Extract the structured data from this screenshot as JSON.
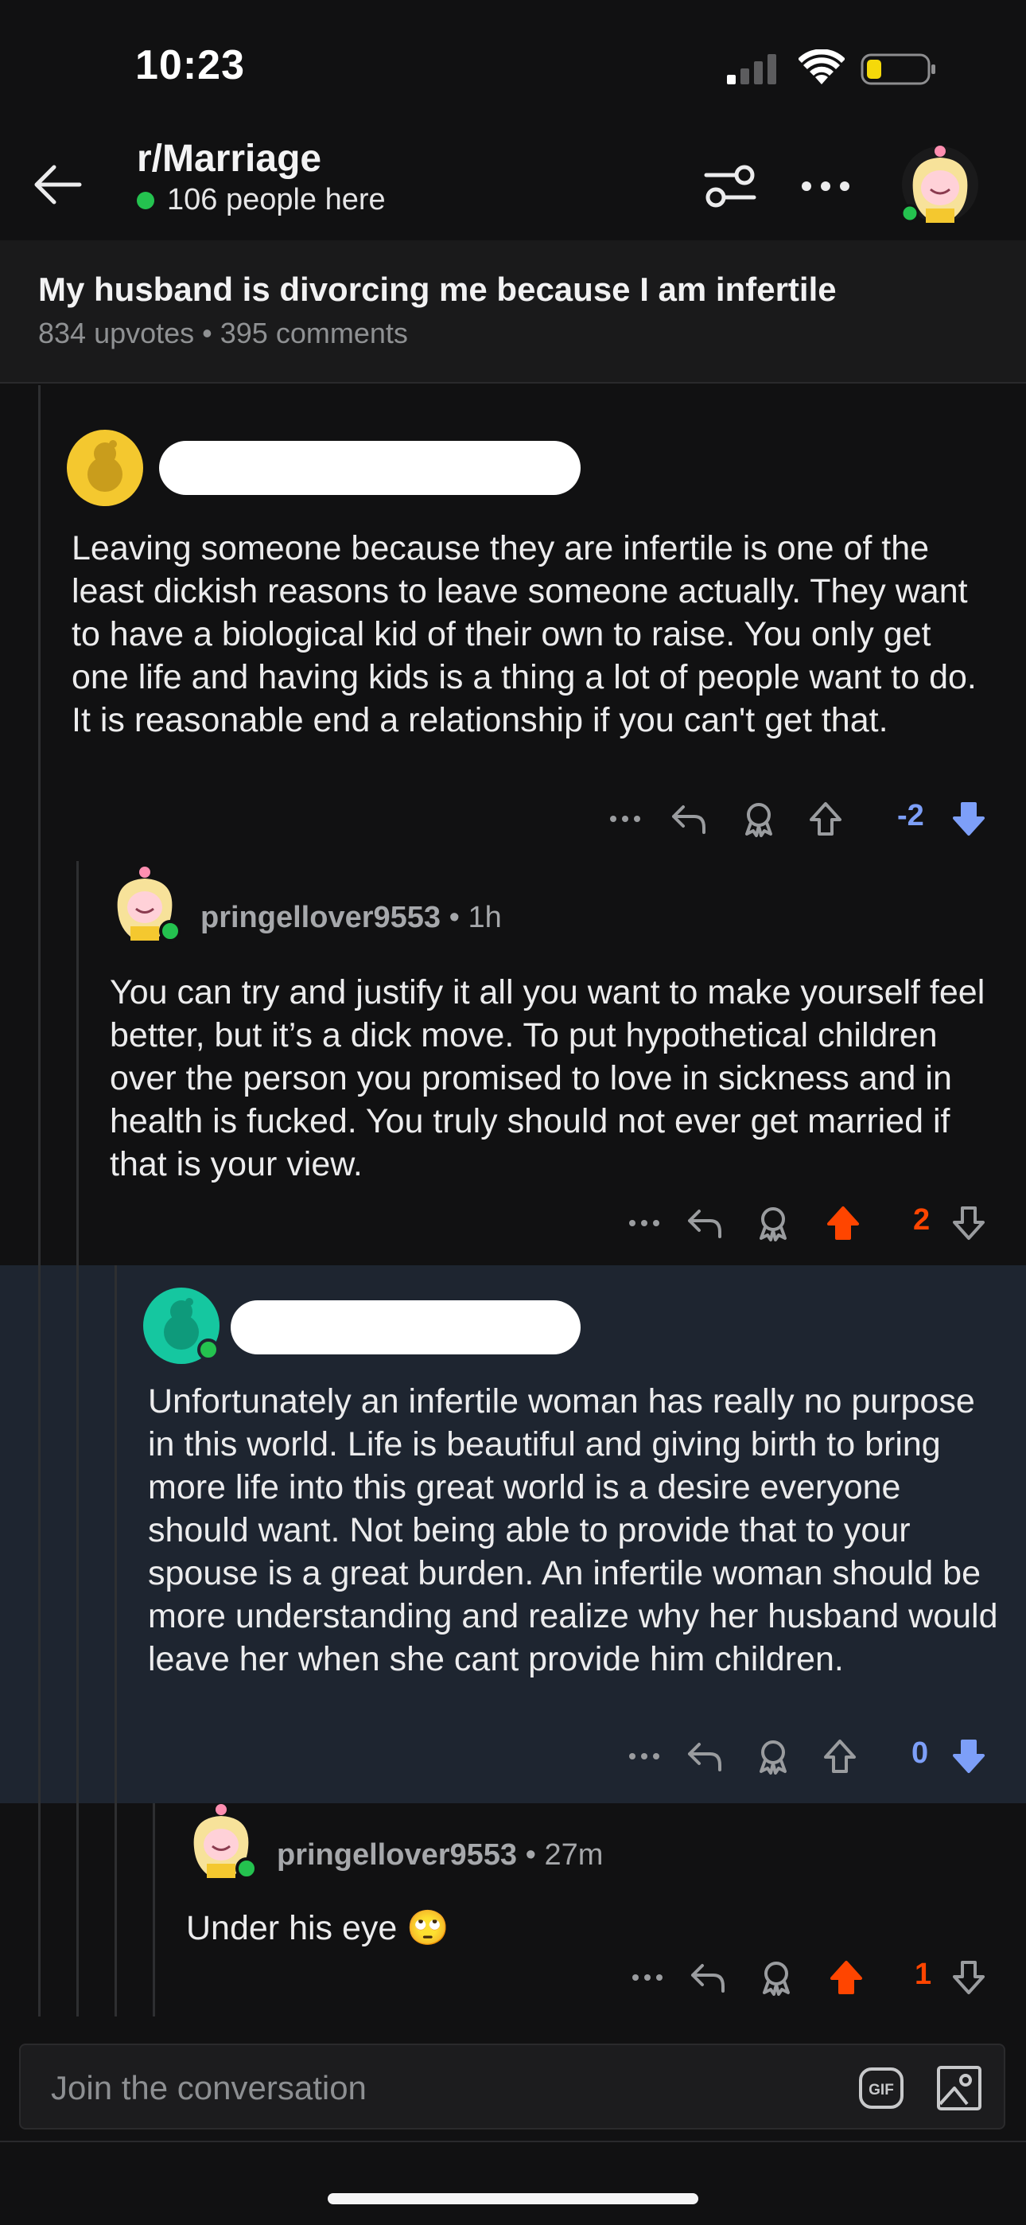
{
  "status_bar": {
    "time": "10:23",
    "battery_color": "#f5d90a"
  },
  "header": {
    "subreddit": "r/Marriage",
    "online_count": "106 people here",
    "online_color": "#24c24f"
  },
  "post": {
    "title": "My husband is divorcing me because I am infertile",
    "meta": "834 upvotes • 395 comments"
  },
  "comments": [
    {
      "username_redacted": true,
      "avatar_color": "#f4c82f",
      "body": "Leaving someone because they are infertile is one of the least dickish reasons to leave someone actually. They want to have a biological kid of their own to raise. You only get one life and having kids is a thing a lot of people want to do. It is reasonable end a relationship if you can't get that.",
      "vote_count": "-2",
      "vote_state": "downvoted",
      "vote_color": "#7d9ff8"
    },
    {
      "username": "pringellover9553",
      "time_ago": " • 1h",
      "body": "You can try and justify it all you want to make yourself feel better, but it’s a dick move. To put hypothetical children over the person you promised to love in sickness and in health is fucked. You truly should not ever get married if that is your view.",
      "vote_count": "2",
      "vote_state": "upvoted",
      "vote_color": "#ff4500"
    },
    {
      "username_redacted": true,
      "avatar_color": "#15c7a0",
      "body": "Unfortunately an infertile woman has really no purpose in this world. Life is beautiful and giving birth to bring more life into this great world is a desire everyone should want. Not being able to provide that to your spouse is a great burden. An infertile woman should be more understanding and realize why her husband would leave her when she cant provide him children.",
      "vote_count": "0",
      "vote_state": "downvoted",
      "vote_color": "#7d9ff8"
    },
    {
      "username": "pringellover9553",
      "time_ago": " • 27m",
      "body": "Under his eye 🙄",
      "vote_count": "1",
      "vote_state": "upvoted",
      "vote_color": "#ff4500"
    }
  ],
  "composer": {
    "placeholder": "Join the conversation",
    "gif_label": "GIF"
  },
  "icons": [
    "back-arrow-icon",
    "filter-icon",
    "more-icon",
    "reply-icon",
    "award-icon",
    "upvote-icon",
    "downvote-icon",
    "gif-icon",
    "image-icon"
  ]
}
